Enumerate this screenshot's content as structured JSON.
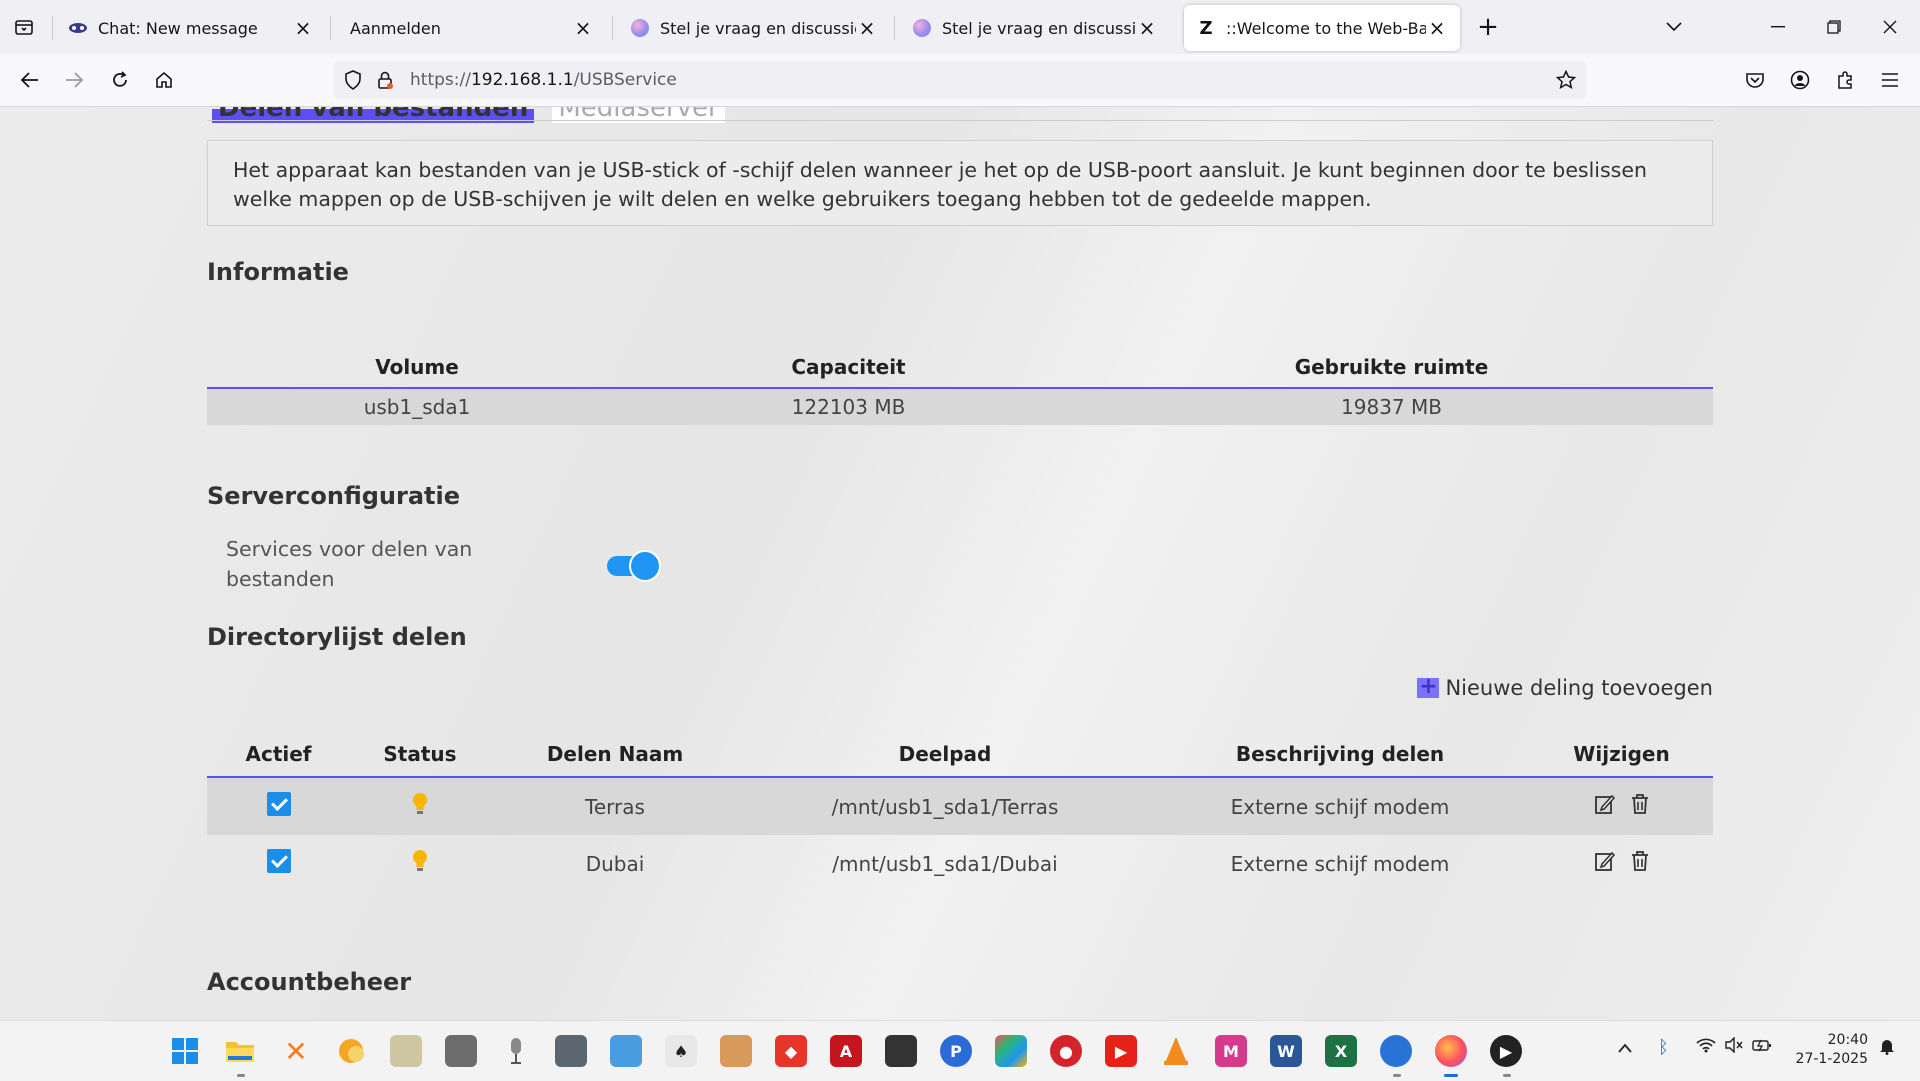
{
  "browser": {
    "tabs": [
      {
        "label": "Chat: New message",
        "icon": "chat-icon",
        "active": false
      },
      {
        "label": "Aanmelden",
        "icon": "",
        "active": false
      },
      {
        "label": "Stel je vraag en discussieer mee",
        "icon": "orb-icon",
        "active": false
      },
      {
        "label": "Stel je vraag en discussieer mee",
        "icon": "orb-icon",
        "active": false
      },
      {
        "label": "::Welcome to the Web-Based C",
        "icon": "z-logo-icon",
        "active": true
      }
    ],
    "url": {
      "proto": "https://",
      "host": "192.168.1.1",
      "path": "/USBService"
    }
  },
  "page": {
    "subtabs": [
      "Delen van bestanden",
      "Mediaserver"
    ],
    "intro": "Het apparaat kan bestanden van je USB-stick of -schijf delen wanneer je het op de USB-poort aansluit. Je kunt beginnen door te beslissen welke mappen op de USB-schijven je wilt delen en welke gebruikers toegang hebben tot de gedeelde mappen.",
    "info": {
      "title": "Informatie",
      "headers": [
        "Volume",
        "Capaciteit",
        "Gebruikte ruimte"
      ],
      "rows": [
        [
          "usb1_sda1",
          "122103 MB",
          "19837 MB"
        ]
      ]
    },
    "server": {
      "title": "Serverconfiguratie",
      "label": "Services voor delen van bestanden",
      "toggle_on": true
    },
    "shares": {
      "title": "Directorylijst delen",
      "add_label": "Nieuwe deling toevoegen",
      "headers": [
        "Actief",
        "Status",
        "Delen Naam",
        "Deelpad",
        "Beschrijving delen",
        "Wijzigen"
      ],
      "rows": [
        {
          "active": true,
          "name": "Terras",
          "path": "/mnt/usb1_sda1/Terras",
          "desc": "Externe schijf modem"
        },
        {
          "active": true,
          "name": "Dubai",
          "path": "/mnt/usb1_sda1/Dubai",
          "desc": "Externe schijf modem"
        }
      ]
    },
    "account": {
      "title": "Accountbeheer"
    }
  },
  "taskbar": {
    "clock_time": "20:40",
    "clock_date": "27-1-2025"
  }
}
